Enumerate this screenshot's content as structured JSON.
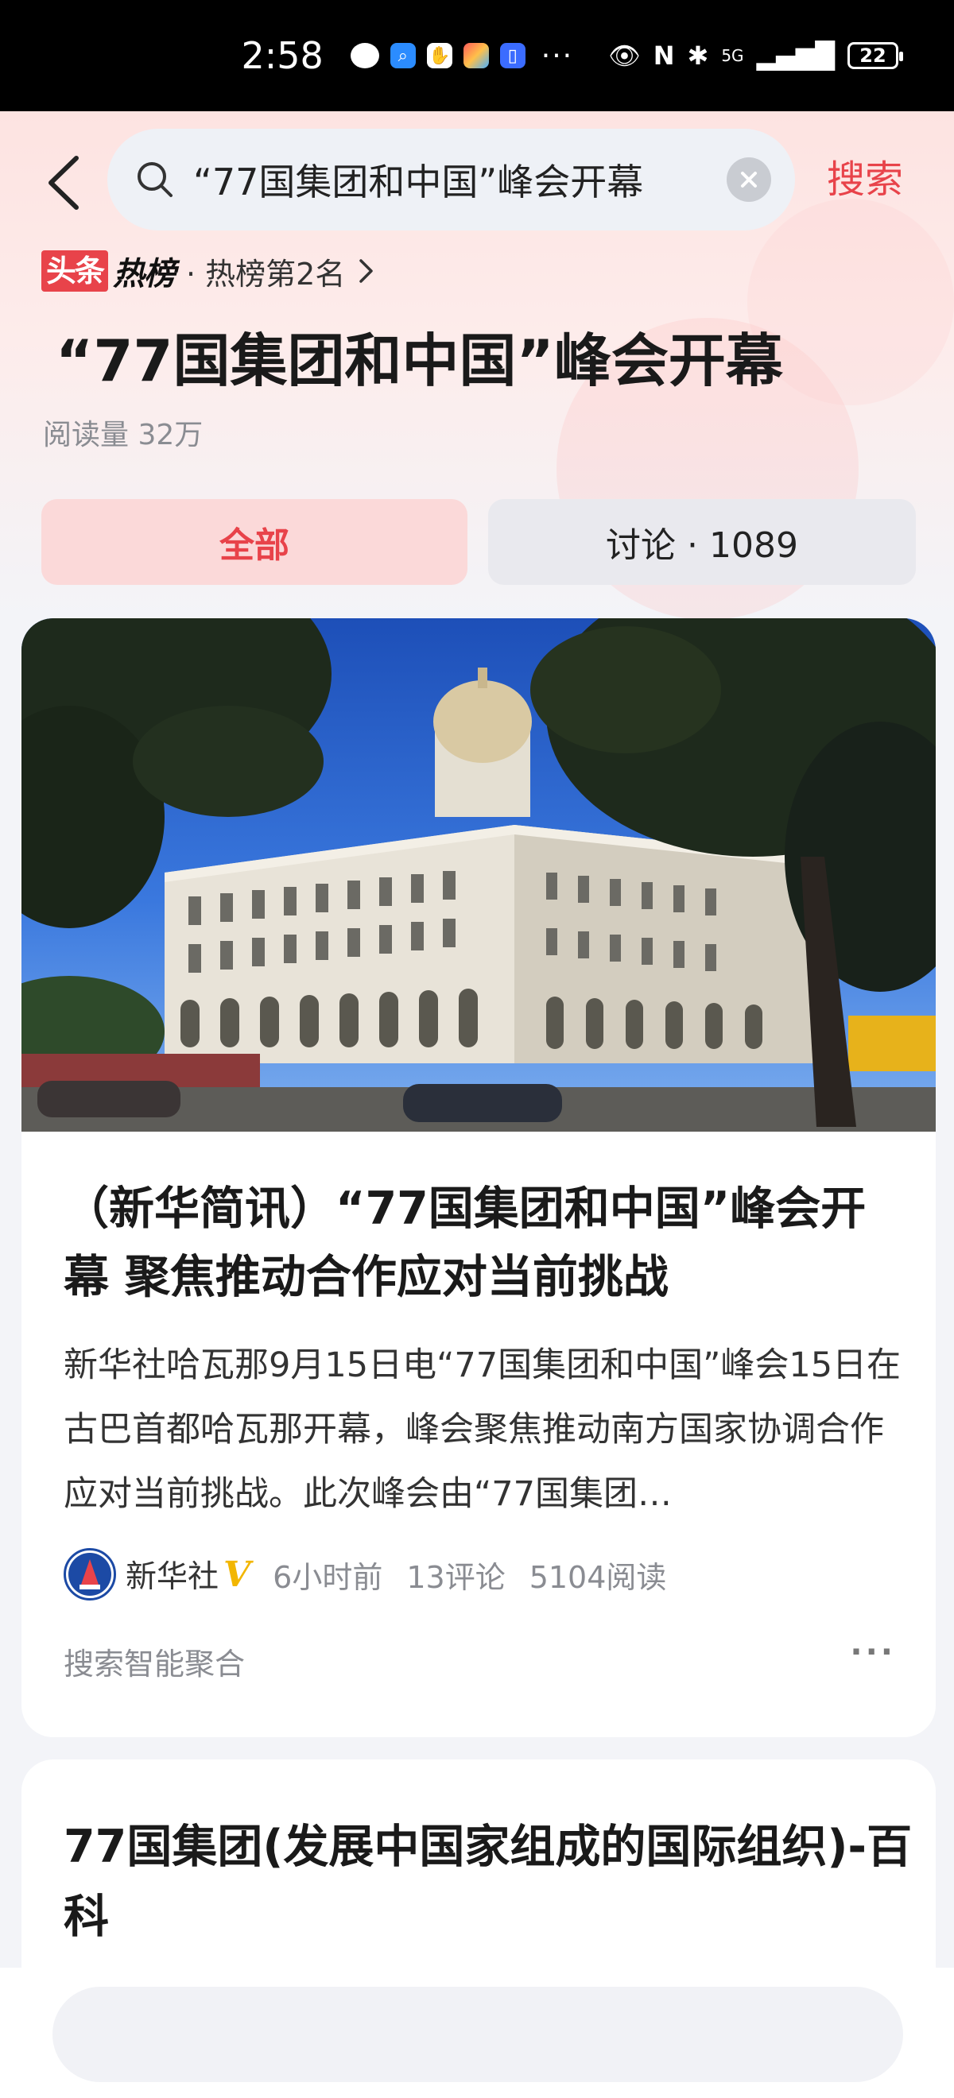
{
  "status_bar": {
    "time": "2:58",
    "battery": "22",
    "signal": "5G",
    "more": "···"
  },
  "search": {
    "query": "“77国集团和中国”峰会开幕",
    "button_label": "搜索"
  },
  "hot_list": {
    "logo_box": "头条",
    "logo_text": "热榜",
    "rank_text": "· 热榜第2名"
  },
  "topic": {
    "title": "“77国集团和中国”峰会开幕",
    "read_count": "阅读量 32万"
  },
  "tabs": [
    {
      "label": "全部",
      "active": true
    },
    {
      "label": "讨论 · 1089",
      "active": false
    }
  ],
  "article": {
    "title": "（新华简讯）“77国集团和中国”峰会开幕 聚焦推动合作应对当前挑战",
    "summary": "新华社哈瓦那9月15日电“77国集团和中国”峰会15日在古巴首都哈瓦那开幕，峰会聚焦推动南方国家协调合作应对当前挑战。此次峰会由“77国集团…",
    "source": "新华社",
    "verified_mark": "V",
    "time": "6小时前",
    "comments": "13评论",
    "reads": "5104阅读",
    "footer": "搜索智能聚合",
    "more": "···"
  },
  "article2": {
    "title": "77国集团(发展中国家组成的国际组织)-百科"
  },
  "colors": {
    "accent": "#e8434a",
    "verified": "#f2b600"
  }
}
